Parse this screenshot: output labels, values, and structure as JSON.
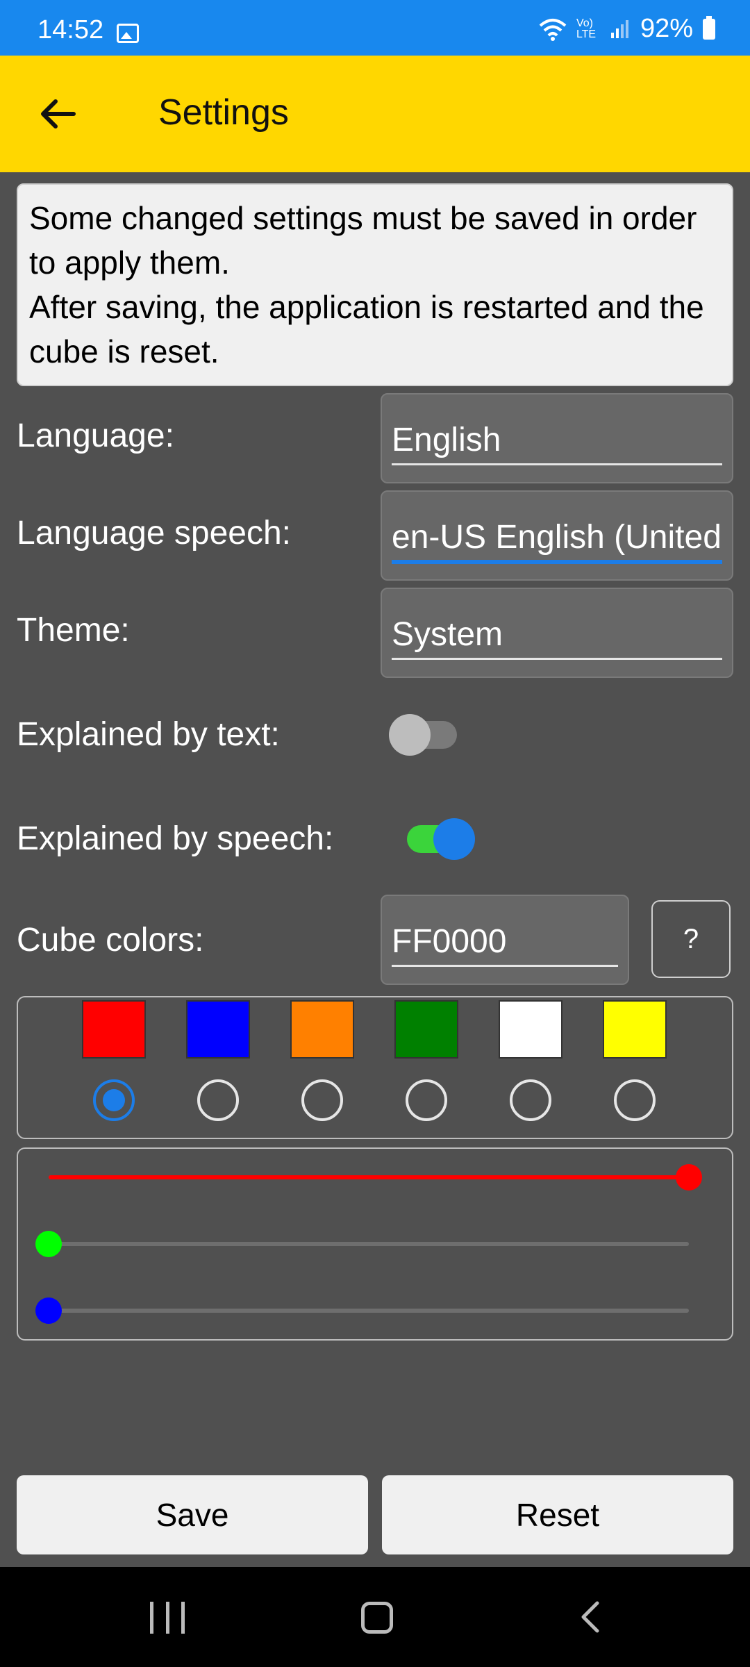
{
  "status_bar": {
    "time": "14:52",
    "battery": "92%",
    "network": "Vo) LTE"
  },
  "app_bar": {
    "title": "Settings"
  },
  "notice": {
    "line1": "Some changed settings must be saved in order to apply them.",
    "line2": "After saving, the application is restarted and the cube is reset."
  },
  "settings": {
    "language_label": "Language:",
    "language_value": "English",
    "language_speech_label": "Language speech:",
    "language_speech_value": "en-US English (United",
    "theme_label": "Theme:",
    "theme_value": "System",
    "explained_text_label": "Explained by text:",
    "explained_text_on": false,
    "explained_speech_label": "Explained by speech:",
    "explained_speech_on": true,
    "cube_colors_label": "Cube colors:",
    "cube_colors_value": "FF0000",
    "help_label": "?"
  },
  "swatches": [
    {
      "color": "#ff0000",
      "selected": true
    },
    {
      "color": "#0000ff",
      "selected": false
    },
    {
      "color": "#ff8000",
      "selected": false
    },
    {
      "color": "#008000",
      "selected": false
    },
    {
      "color": "#ffffff",
      "selected": false
    },
    {
      "color": "#ffff00",
      "selected": false
    }
  ],
  "sliders": [
    {
      "name": "red",
      "color": "#ff0000",
      "value": 255,
      "max": 255
    },
    {
      "name": "green",
      "color": "#00ff00",
      "value": 0,
      "max": 255
    },
    {
      "name": "blue",
      "color": "#0000ff",
      "value": 0,
      "max": 255
    }
  ],
  "buttons": {
    "save": "Save",
    "reset": "Reset"
  },
  "colors": {
    "appbar": "#ffd700",
    "statusbar": "#1888ee",
    "background": "#505050",
    "accent": "#1c7de8"
  }
}
